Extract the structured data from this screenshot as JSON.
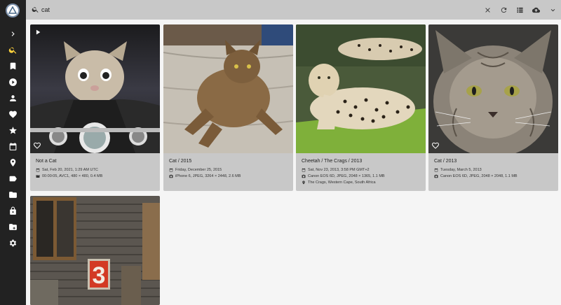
{
  "search": {
    "query": "cat"
  },
  "nav": {
    "items": [
      {
        "icon": "chevron-right-icon"
      },
      {
        "icon": "search-icon",
        "active": true
      },
      {
        "icon": "bookmark-icon"
      },
      {
        "icon": "play-circle-icon"
      },
      {
        "icon": "person-icon"
      },
      {
        "icon": "heart-icon"
      },
      {
        "icon": "star-icon"
      },
      {
        "icon": "calendar-icon"
      },
      {
        "icon": "place-icon"
      },
      {
        "icon": "label-icon"
      },
      {
        "icon": "folder-icon"
      },
      {
        "icon": "lock-icon"
      },
      {
        "icon": "library-icon"
      },
      {
        "icon": "settings-icon"
      }
    ]
  },
  "toolbar_icons": [
    "close-icon",
    "refresh-icon",
    "list-view-icon",
    "cloud-upload-icon",
    "chevron-down-icon"
  ],
  "accent_color": "#ffd23c",
  "cards": [
    {
      "title": "Not a Cat",
      "date": "Sat, Feb 20, 2021, 1:29 AM UTC",
      "detail": "00:00:05, AVC1, 480 × 480, 0.4 MB",
      "location": "",
      "is_video": true
    },
    {
      "title": "Cat / 2015",
      "date": "Friday, December 25, 2015",
      "detail": "iPhone 6, JPEG, 3264 × 2448, 2.6 MB",
      "location": ""
    },
    {
      "title": "Cheetah / The Crags / 2013",
      "date": "Sat, Nov 23, 2013, 3:58 PM GMT+2",
      "detail": "Canon EOS 6D, JPEG, 2048 × 1365, 1.1 MB",
      "location": "The Crags, Western Cape, South Africa"
    },
    {
      "title": "Cat / 2013",
      "date": "Tuesday, March 5, 2013",
      "detail": "Canon EOS 6D, JPEG, 2048 × 2048, 1.1 MB",
      "location": ""
    }
  ]
}
